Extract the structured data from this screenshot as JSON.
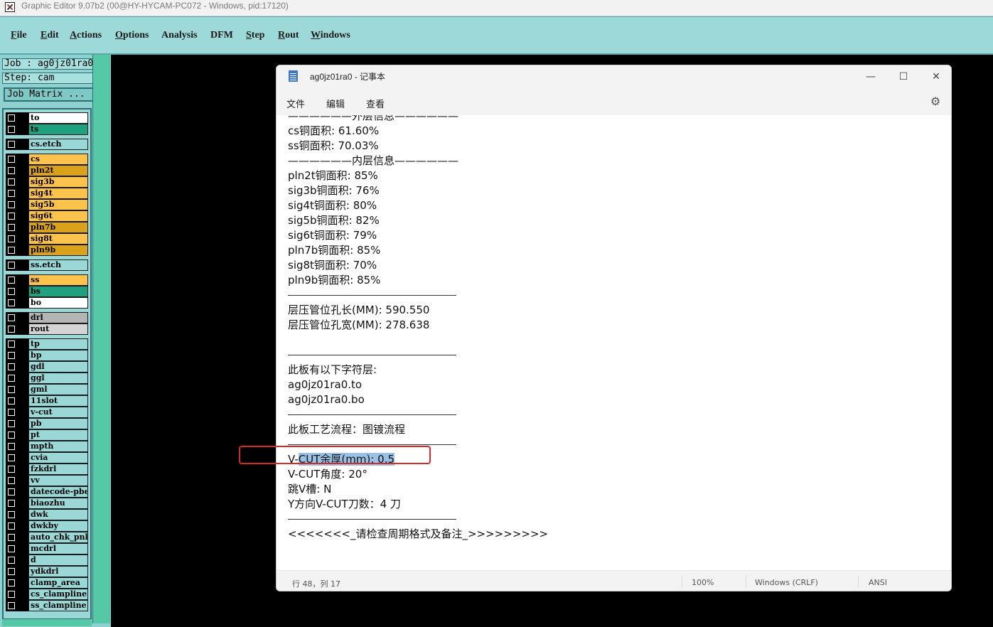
{
  "ge_window": {
    "title": "Graphic Editor 9.07b2 (00@HY-HYCAM-PC072 - Windows, pid:17120)",
    "menu": [
      {
        "label": "File",
        "ul": "F",
        "rest": "ile"
      },
      {
        "label": "Edit",
        "ul": "E",
        "rest": "dit"
      },
      {
        "label": "Actions",
        "ul": "A",
        "rest": "ctions"
      },
      {
        "label": "Options",
        "ul": "O",
        "rest": "ptions"
      },
      {
        "label": "Analysis",
        "ul": "",
        "rest": "Analysis"
      },
      {
        "label": "DFM",
        "ul": "",
        "rest": "DFM"
      },
      {
        "label": "Step",
        "ul": "S",
        "rest": "tep"
      },
      {
        "label": "Rout",
        "ul": "R",
        "rest": "out"
      },
      {
        "label": "Windows",
        "ul": "W",
        "rest": "indows"
      }
    ]
  },
  "left_panel": {
    "job": "Job : ag0jz01ra0",
    "step": "Step: cam",
    "job_matrix_button": "Job Matrix ..."
  },
  "layers": [
    {
      "name": "to",
      "color": "#ffffff"
    },
    {
      "name": "ts",
      "color": "#1fa07e"
    },
    {
      "name": "cs.etch",
      "color": "#9ad8d8"
    },
    {
      "name": "cs",
      "color": "#ffc24a"
    },
    {
      "name": "pln2t",
      "color": "#d9a21a"
    },
    {
      "name": "sig3b",
      "color": "#ffc24a"
    },
    {
      "name": "sig4t",
      "color": "#ffc24a"
    },
    {
      "name": "sig5b",
      "color": "#ffc24a"
    },
    {
      "name": "sig6t",
      "color": "#ffc24a"
    },
    {
      "name": "pln7b",
      "color": "#d9a21a"
    },
    {
      "name": "sig8t",
      "color": "#ffc24a"
    },
    {
      "name": "pln9b",
      "color": "#d9a21a"
    },
    {
      "name": "ss.etch",
      "color": "#9ad8d8"
    },
    {
      "name": "ss",
      "color": "#ffc24a"
    },
    {
      "name": "bs",
      "color": "#1fa07e"
    },
    {
      "name": "bo",
      "color": "#ffffff"
    },
    {
      "name": "drl",
      "color": "#b4b4b4"
    },
    {
      "name": "rout",
      "color": "#d4d4d4"
    },
    {
      "name": "tp",
      "color": "#9ad8d8"
    },
    {
      "name": "bp",
      "color": "#9ad8d8"
    },
    {
      "name": "gdl",
      "color": "#9ad8d8"
    },
    {
      "name": "ggl",
      "color": "#9ad8d8"
    },
    {
      "name": "gml",
      "color": "#9ad8d8"
    },
    {
      "name": "11slot",
      "color": "#9ad8d8"
    },
    {
      "name": "v-cut",
      "color": "#9ad8d8"
    },
    {
      "name": "pb",
      "color": "#9ad8d8"
    },
    {
      "name": "pt",
      "color": "#9ad8d8"
    },
    {
      "name": "mpth",
      "color": "#9ad8d8"
    },
    {
      "name": "cvia",
      "color": "#9ad8d8"
    },
    {
      "name": "fzkdrl",
      "color": "#9ad8d8"
    },
    {
      "name": "vv",
      "color": "#9ad8d8"
    },
    {
      "name": "datecode-pbe",
      "color": "#9ad8d8"
    },
    {
      "name": "biaozhu",
      "color": "#9ad8d8"
    },
    {
      "name": "dwk",
      "color": "#9ad8d8"
    },
    {
      "name": "dwkby",
      "color": "#9ad8d8"
    },
    {
      "name": "auto_chk_pnl",
      "color": "#9ad8d8"
    },
    {
      "name": "mcdrl",
      "color": "#9ad8d8"
    },
    {
      "name": "d",
      "color": "#9ad8d8"
    },
    {
      "name": "ydkdrl",
      "color": "#9ad8d8"
    },
    {
      "name": "clamp_area",
      "color": "#9ad8d8"
    },
    {
      "name": "cs_clampline",
      "color": "#9ad8d8"
    },
    {
      "name": "ss_clampline",
      "color": "#9ad8d8"
    }
  ],
  "notepad": {
    "title": "ag0jz01ra0 - 记事本",
    "menu": [
      "文件",
      "编辑",
      "查看"
    ],
    "lines": [
      {
        "text": "——————外层信息——————",
        "clip": true
      },
      {
        "text": "cs铜面积: 61.60%"
      },
      {
        "text": "ss铜面积: 70.03%"
      },
      {
        "text": "——————内层信息——————"
      },
      {
        "text": "pln2t铜面积: 85%"
      },
      {
        "text": "sig3b铜面积: 76%"
      },
      {
        "text": "sig4t铜面积: 80%"
      },
      {
        "text": "sig5b铜面积: 82%"
      },
      {
        "text": "sig6t铜面积: 79%"
      },
      {
        "text": "pln7b铜面积: 85%"
      },
      {
        "text": "sig8t铜面积: 70%"
      },
      {
        "text": "pln9b铜面积: 85%"
      },
      {
        "hr": true
      },
      {
        "text": "层压管位孔长(MM): 590.550"
      },
      {
        "text": "层压管位孔宽(MM): 278.638"
      },
      {
        "text": ""
      },
      {
        "hr": true
      },
      {
        "text": "此板有以下字符层:"
      },
      {
        "text": "ag0jz01ra0.to"
      },
      {
        "text": "ag0jz01ra0.bo"
      },
      {
        "hr": true
      },
      {
        "text": "此板工艺流程：图镀流程"
      },
      {
        "hr": true
      },
      {
        "text": "V-CUT余厚(mm): 0.5",
        "sel_start": 2
      },
      {
        "text": "V-CUT角度: 20°"
      },
      {
        "text": "跳V槽: N"
      },
      {
        "text": "Y方向V-CUT刀数：4 刀"
      },
      {
        "hr": true
      },
      {
        "text": "<<<<<<<_请检查周期格式及备注_>>>>>>>>>"
      }
    ],
    "status": {
      "position": "行 48，列 17",
      "zoom": "100%",
      "line_ending": "Windows (CRLF)",
      "encoding": "ANSI"
    }
  }
}
